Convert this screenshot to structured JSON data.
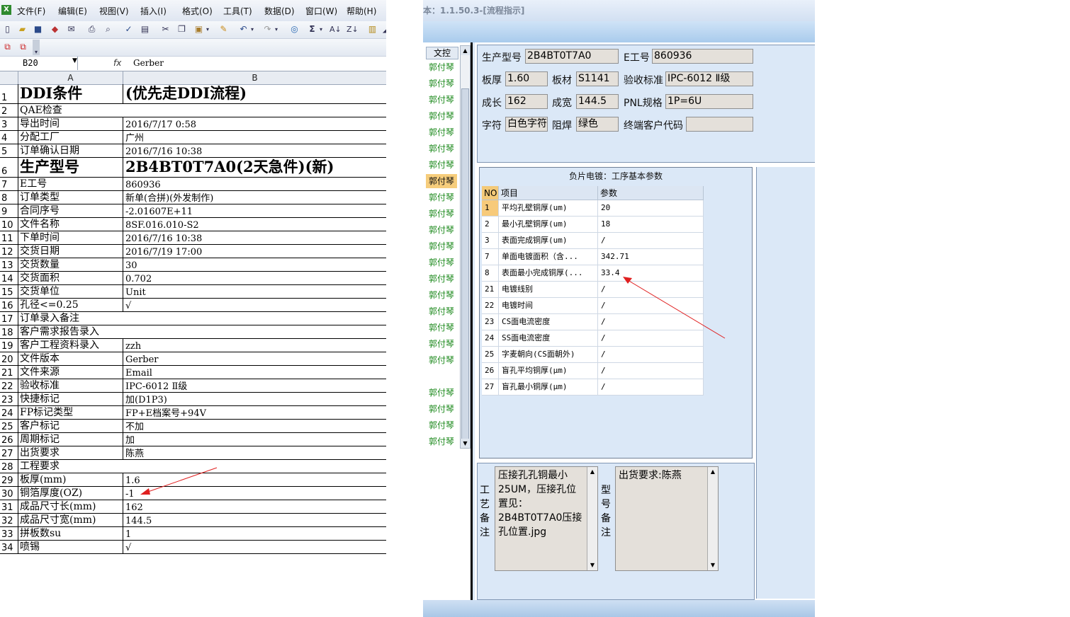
{
  "excel": {
    "menu": [
      "文件(F)",
      "编辑(E)",
      "视图(V)",
      "插入(I)",
      "格式(O)",
      "工具(T)",
      "数据(D)",
      "窗口(W)",
      "帮助(H)"
    ],
    "name_box": "B20",
    "fx_label": "fx",
    "formula_value": "Gerber",
    "col_a": "A",
    "col_b": "B",
    "rows": [
      {
        "n": "1",
        "a": "DDI条件",
        "b": "(优先走DDI流程)"
      },
      {
        "n": "2",
        "a": "QAE检查",
        "b": ""
      },
      {
        "n": "3",
        "a": "导出时间",
        "b": "2016/7/17 0:58"
      },
      {
        "n": "4",
        "a": "分配工厂",
        "b": "广州"
      },
      {
        "n": "5",
        "a": "订单确认日期",
        "b": "2016/7/16 10:38"
      },
      {
        "n": "6",
        "a": "生产型号",
        "b": "2B4BT0T7A0(2天急件)(新)"
      },
      {
        "n": "7",
        "a": "E工号",
        "b": "860936"
      },
      {
        "n": "8",
        "a": "订单类型",
        "b": "新单(合拼)(外发制作)"
      },
      {
        "n": "9",
        "a": "合同序号",
        "b": "-2.01607E+11"
      },
      {
        "n": "10",
        "a": "文件名称",
        "b": "8SF.016.010-S2"
      },
      {
        "n": "11",
        "a": "下单时间",
        "b": "2016/7/16 10:38"
      },
      {
        "n": "12",
        "a": "交货日期",
        "b": "2016/7/19 17:00"
      },
      {
        "n": "13",
        "a": "交货数量",
        "b": "30"
      },
      {
        "n": "14",
        "a": "交货面积",
        "b": "0.702"
      },
      {
        "n": "15",
        "a": "交货单位",
        "b": "Unit"
      },
      {
        "n": "16",
        "a": "孔径<=0.25",
        "b": "√"
      },
      {
        "n": "17",
        "a": "订单录入备注",
        "b": ""
      },
      {
        "n": "18",
        "a": "客户需求报告录入",
        "b": ""
      },
      {
        "n": "19",
        "a": "客户工程资料录入",
        "b": "zzh"
      },
      {
        "n": "20",
        "a": "文件版本",
        "b": "Gerber"
      },
      {
        "n": "21",
        "a": "文件来源",
        "b": "Email"
      },
      {
        "n": "22",
        "a": "验收标准",
        "b": "IPC-6012 Ⅱ级"
      },
      {
        "n": "23",
        "a": "快捷标记",
        "b": "加(D1P3)"
      },
      {
        "n": "24",
        "a": "FP标记类型",
        "b": "FP+E档案号+94V"
      },
      {
        "n": "25",
        "a": "客户标记",
        "b": "不加"
      },
      {
        "n": "26",
        "a": "周期标记",
        "b": "加"
      },
      {
        "n": "27",
        "a": "出货要求",
        "b": "陈燕"
      },
      {
        "n": "28",
        "a": "工程要求",
        "b": ""
      },
      {
        "n": "29",
        "a": "板厚(mm)",
        "b": "1.6"
      },
      {
        "n": "30",
        "a": "铜箔厚度(OZ)",
        "b": "-1"
      },
      {
        "n": "31",
        "a": "成品尺寸长(mm)",
        "b": "162"
      },
      {
        "n": "32",
        "a": "成品尺寸宽(mm)",
        "b": "144.5"
      },
      {
        "n": "33",
        "a": "拼板数su",
        "b": "1"
      },
      {
        "n": "34",
        "a": "喷锡",
        "b": "√"
      }
    ],
    "arrow_color": "#e02020"
  },
  "app": {
    "title": "本：1.1.50.3-[流程指示]",
    "sidebar_header": "文控",
    "sidebar_items": [
      "郭付琴",
      "郭付琴",
      "郭付琴",
      "郭付琴",
      "郭付琴",
      "郭付琴",
      "郭付琴",
      "郭付琴",
      "郭付琴",
      "郭付琴",
      "郭付琴",
      "郭付琴",
      "郭付琴",
      "郭付琴",
      "郭付琴",
      "郭付琴",
      "郭付琴",
      "郭付琴",
      "郭付琴",
      "",
      "郭付琴",
      "郭付琴",
      "郭付琴",
      "郭付琴"
    ],
    "sidebar_selected_index": 7,
    "info": {
      "model_label": "生产型号",
      "model_value": "2B4BT0T7A0",
      "eno_label": "E工号",
      "eno_value": "860936",
      "thickness_label": "板厚",
      "thickness_value": "1.60",
      "material_label": "板材",
      "material_value": "S1141",
      "standard_label": "验收标准",
      "standard_value": "IPC-6012 Ⅱ级",
      "length_label": "成长",
      "length_value": "162",
      "width_label": "成宽",
      "width_value": "144.5",
      "pnl_label": "PNL规格",
      "pnl_value": "1P=6U",
      "char_label": "字符",
      "char_value": "白色字符",
      "mask_label": "阻焊",
      "mask_value": "绿色",
      "endcust_label": "终端客户代码",
      "endcust_value": ""
    },
    "table": {
      "title": "负片电镀：工序基本参数",
      "headers": [
        "NO",
        "项目",
        "参数"
      ],
      "rows": [
        {
          "no": "1",
          "item": "平均孔壁铜厚(um)",
          "val": "20"
        },
        {
          "no": "2",
          "item": "最小孔壁铜厚(um)",
          "val": "18"
        },
        {
          "no": "3",
          "item": "表面完成铜厚(um)",
          "val": "/"
        },
        {
          "no": "7",
          "item": "单面电镀面积（含...",
          "val": "342.71"
        },
        {
          "no": "8",
          "item": "表面最小完成铜厚(...",
          "val": "33.4"
        },
        {
          "no": "21",
          "item": "电镀线别",
          "val": "/"
        },
        {
          "no": "22",
          "item": "电镀时间",
          "val": "/"
        },
        {
          "no": "23",
          "item": "CS面电流密度",
          "val": "/"
        },
        {
          "no": "24",
          "item": "SS面电流密度",
          "val": "/"
        },
        {
          "no": "25",
          "item": "字麦朝向(CS面朝外)",
          "val": "/"
        },
        {
          "no": "26",
          "item": "盲孔平均铜厚(μm)",
          "val": "/"
        },
        {
          "no": "27",
          "item": "盲孔最小铜厚(μm)",
          "val": "/"
        }
      ]
    },
    "notes": {
      "process_label": [
        "工",
        "艺",
        "备",
        "注"
      ],
      "process_text": [
        "压接孔孔铜最小",
        "25UM，压接孔位",
        "置见：",
        "2B4BT0T7A0压接",
        "孔位置.jpg"
      ],
      "model_label": [
        "型",
        "号",
        "备",
        "注"
      ],
      "model_text": [
        "出货要求:陈燕"
      ]
    }
  }
}
